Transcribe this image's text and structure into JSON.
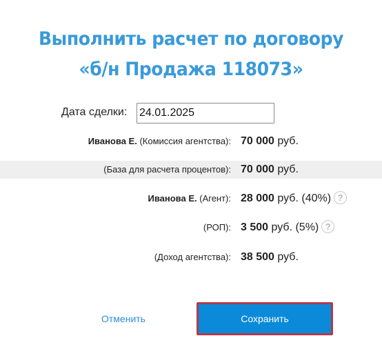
{
  "title": {
    "line1": "Выполнить расчет по договору",
    "line2": "«б/н Продажа 118073»"
  },
  "date": {
    "label": "Дата сделки:",
    "value": "24.01.2025"
  },
  "rows": [
    {
      "name": "Иванова Е.",
      "label": "(Комиссия агентства):",
      "amount": "70 000",
      "currency": "руб.",
      "percent": ""
    },
    {
      "name": "",
      "label": "(База для расчета процентов):",
      "amount": "70 000",
      "currency": "руб.",
      "percent": ""
    },
    {
      "name": "Иванова Е.",
      "label": "(Агент):",
      "amount": "28 000",
      "currency": "руб.",
      "percent": "(40%)"
    },
    {
      "name": "",
      "label": "(РОП):",
      "amount": "3 500",
      "currency": "руб.",
      "percent": "(5%)"
    },
    {
      "name": "",
      "label": "(Доход агентства):",
      "amount": "38 500",
      "currency": "руб.",
      "percent": ""
    }
  ],
  "help_glyph": "?",
  "actions": {
    "cancel_label": "Отменить",
    "save_label": "Сохранить"
  },
  "colors": {
    "title": "#3a9ad9",
    "primary_button": "#0a8ad8",
    "button_outline": "#b23a4a",
    "link": "#2d8fd5",
    "shaded_row": "#efefef"
  },
  "icons": {
    "help": "question-circle-icon"
  }
}
